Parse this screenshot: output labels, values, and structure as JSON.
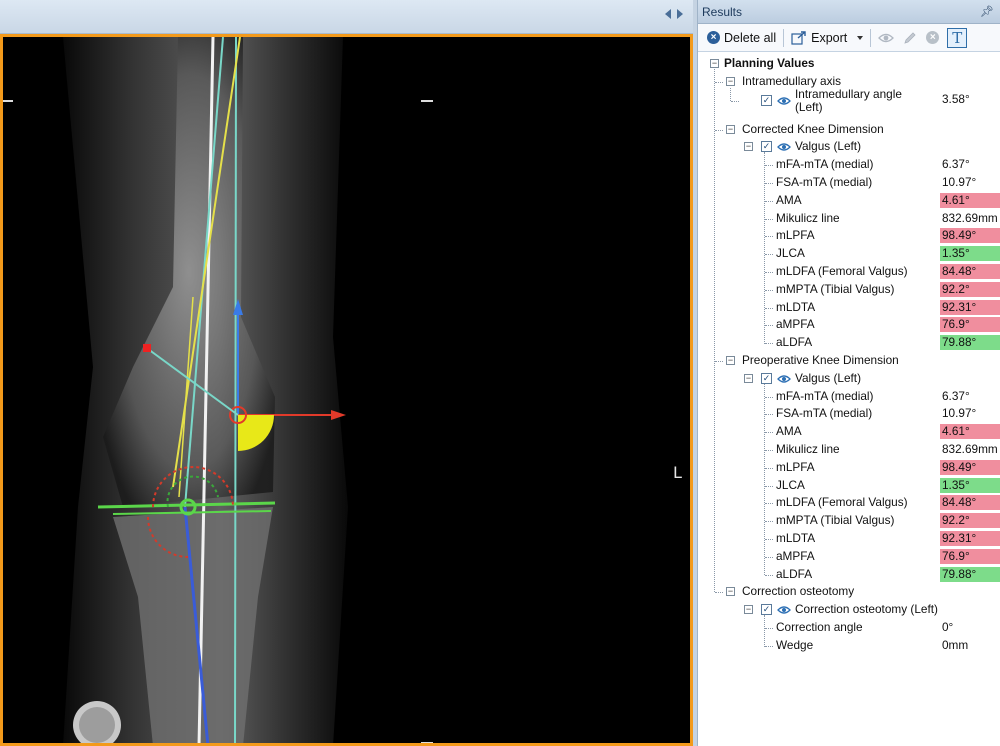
{
  "viewer": {
    "side_marker": "L"
  },
  "results": {
    "title": "Results",
    "pin_icon": "pin-icon",
    "toolbar": {
      "delete_all": "Delete all",
      "export": "Export",
      "icons": [
        "delete-icon",
        "export-icon",
        "eye-icon",
        "pencil-icon",
        "delete-grey-icon",
        "text-icon"
      ]
    },
    "tree": {
      "root": "Planning Values",
      "intramedullary": {
        "label": "Intramedullary axis",
        "item_label": "Intramedullary angle (Left)",
        "item_value": "3.58°"
      },
      "corrected": {
        "label": "Corrected Knee Dimension",
        "item_label": "Valgus (Left)",
        "rows": [
          {
            "label": "mFA-mTA (medial)",
            "value": "6.37°",
            "status": "none"
          },
          {
            "label": "FSA-mTA (medial)",
            "value": "10.97°",
            "status": "none"
          },
          {
            "label": "AMA",
            "value": "4.61°",
            "status": "red"
          },
          {
            "label": "Mikulicz line",
            "value": "832.69mm",
            "status": "none"
          },
          {
            "label": "mLPFA",
            "value": "98.49°",
            "status": "red"
          },
          {
            "label": "JLCA",
            "value": "1.35°",
            "status": "green"
          },
          {
            "label": "mLDFA (Femoral Valgus)",
            "value": "84.48°",
            "status": "red"
          },
          {
            "label": "mMPTA (Tibial Valgus)",
            "value": "92.2°",
            "status": "red"
          },
          {
            "label": "mLDTA",
            "value": "92.31°",
            "status": "red"
          },
          {
            "label": "aMPFA",
            "value": "76.9°",
            "status": "red"
          },
          {
            "label": "aLDFA",
            "value": "79.88°",
            "status": "green"
          }
        ]
      },
      "preoperative": {
        "label": "Preoperative Knee Dimension",
        "item_label": "Valgus (Left)",
        "rows": [
          {
            "label": "mFA-mTA (medial)",
            "value": "6.37°",
            "status": "none"
          },
          {
            "label": "FSA-mTA (medial)",
            "value": "10.97°",
            "status": "none"
          },
          {
            "label": "AMA",
            "value": "4.61°",
            "status": "red"
          },
          {
            "label": "Mikulicz line",
            "value": "832.69mm",
            "status": "none"
          },
          {
            "label": "mLPFA",
            "value": "98.49°",
            "status": "red"
          },
          {
            "label": "JLCA",
            "value": "1.35°",
            "status": "green"
          },
          {
            "label": "mLDFA (Femoral Valgus)",
            "value": "84.48°",
            "status": "red"
          },
          {
            "label": "mMPTA (Tibial Valgus)",
            "value": "92.2°",
            "status": "red"
          },
          {
            "label": "mLDTA",
            "value": "92.31°",
            "status": "red"
          },
          {
            "label": "aMPFA",
            "value": "76.9°",
            "status": "red"
          },
          {
            "label": "aLDFA",
            "value": "79.88°",
            "status": "green"
          }
        ]
      },
      "osteotomy": {
        "label": "Correction osteotomy",
        "item_label": "Correction osteotomy (Left)",
        "rows": [
          {
            "label": "Correction angle",
            "value": "0°",
            "status": "none"
          },
          {
            "label": "Wedge",
            "value": "0mm",
            "status": "none"
          }
        ]
      }
    }
  },
  "colors": {
    "red": "#f08e9e",
    "green": "#7ddc8a",
    "viewer_border": "#f39a1b"
  }
}
